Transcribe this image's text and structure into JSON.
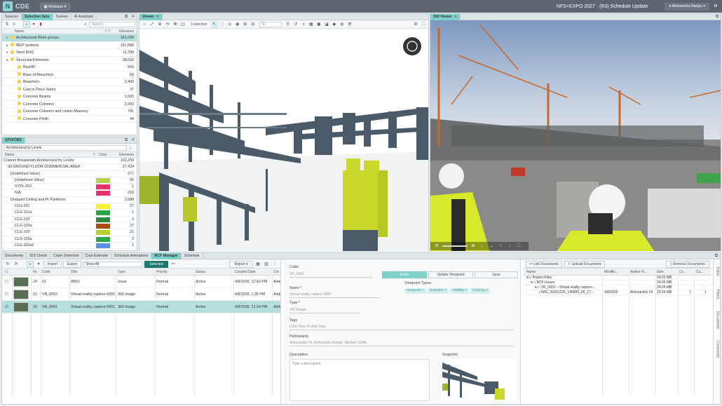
{
  "app": {
    "brand": "CDE",
    "logo": "N",
    "modules_label": "Modules",
    "project_title": "NFS+EXPO 2027 · (R3) Schedule Update",
    "user": "Aleksandra Banjac"
  },
  "left_top": {
    "tabs": [
      "Sources",
      "Selection Sets",
      "Scenes",
      "AI Assistant"
    ],
    "search_placeholder": "Search...",
    "col_name": "Name",
    "col_elements": "Elements",
    "rows": [
      {
        "label": "Architectural Work groups",
        "count": "181,028",
        "level": 0
      },
      {
        "label": "MEP systems",
        "count": "157,886",
        "level": 0
      },
      {
        "label": "Steel BOQ",
        "count": "11,780",
        "level": 0
      },
      {
        "label": "Structural Elements",
        "count": "38,592",
        "level": 0
      },
      {
        "label": "Backfill",
        "count": "665",
        "level": 1
      },
      {
        "label": "Base of Bleachers",
        "count": "69",
        "level": 1
      },
      {
        "label": "Bleachers",
        "count": "2,469",
        "level": 1
      },
      {
        "label": "Cast in Place Stairs",
        "count": "37",
        "level": 1
      },
      {
        "label": "Concrete Beams",
        "count": "1,665",
        "level": 1
      },
      {
        "label": "Concrete Columns",
        "count": "2,050",
        "level": 1
      },
      {
        "label": "Concrete Columns and Lintels Masonry",
        "count": "781",
        "level": 1
      },
      {
        "label": "Concrete Plinth",
        "count": "44",
        "level": 1
      }
    ]
  },
  "left_bottom": {
    "title": "QTO/CBS",
    "dropdown": "Architectural by Levels",
    "col_name": "Name",
    "col_color": "Color",
    "col_elements": "Elements",
    "rows": [
      {
        "label": "Custom Breakdown Architectural by Levels",
        "count": "133,209",
        "color": ""
      },
      {
        "label": "00 GROUND FLOOR COMMERCIAL AREA",
        "count": "27,424",
        "color": ""
      },
      {
        "label": "[Undefined Value]",
        "count": "277",
        "color": ""
      },
      {
        "label": "[Undefined Value]",
        "count": "66",
        "color": "#b6d24a"
      },
      {
        "label": "SYPL-002",
        "count": "1",
        "color": "#e8336a"
      },
      {
        "label": "N/A",
        "count": "210",
        "color": "#e8336a"
      },
      {
        "label": "Dropped Ceiling and Pr Partitions",
        "count": "1,088",
        "color": ""
      },
      {
        "label": "CLG-101",
        "count": "27",
        "color": "#f5f230"
      },
      {
        "label": "CLG-101a",
        "count": "1",
        "color": "#29a846"
      },
      {
        "label": "CLG-102",
        "count": "3",
        "color": "#2a8a3a"
      },
      {
        "label": "CLG-102a",
        "count": "27",
        "color": "#b04a10"
      },
      {
        "label": "CLG-103",
        "count": "21",
        "color": "#b5d32c"
      },
      {
        "label": "CLG-103a",
        "count": "3",
        "color": "#2aa84a"
      },
      {
        "label": "CLG-103a2",
        "count": "1",
        "color": "#5b8ee8"
      }
    ]
  },
  "viewer": {
    "tab": "Viewer",
    "selected": "3 selected",
    "zoom": "%"
  },
  "viewer360": {
    "tab": "360 Viewer"
  },
  "bottom": {
    "tabs": [
      "Documents",
      "IDS Check",
      "Clash Detection",
      "Cost Estimate",
      "Schedule Animations",
      "BCF Manager",
      "Schedule"
    ],
    "active_tab": "BCF Manager",
    "import": "Import",
    "export": "Export",
    "show_all": "Show All",
    "selected": "Selected",
    "report": "Report",
    "cols": [
      "Nr.",
      "Code",
      "Title",
      "Type",
      "Priority",
      "Status",
      "Created Date",
      "Cre"
    ],
    "rows": [
      {
        "nr": "24",
        "code": "01",
        "title": "AB01",
        "type": "Issue",
        "priority": "Normal",
        "status": "Active",
        "date": "4/8/2026, 12:42 PM",
        "cre": "Alek"
      },
      {
        "nr": "22",
        "code": "VR_0002",
        "title": "Virtual reality capture 0002",
        "type": "360 Image",
        "priority": "Normal",
        "status": "Active",
        "date": "4/8/2026, 1:35 PM",
        "cre": "Alek"
      },
      {
        "nr": "20",
        "code": "VR_0001",
        "title": "Virtual reality capture 0001",
        "type": "360 Image",
        "priority": "Normal",
        "status": "Active",
        "date": "4/8/2026, 12:24 PM",
        "cre": "Alek"
      }
    ]
  },
  "detail": {
    "code_label": "Code:",
    "code_value": "VR_0001",
    "active": "Active",
    "update_viewpoint": "Update Viewpoint",
    "save": "Save",
    "name_label": "Name *",
    "name_value": "Virtual reality capture 0001",
    "vp_types_label": "Viewpoint Types:",
    "vp_types": [
      "Viewpoint ×",
      "Selection ×",
      "Visibility ×",
      "Coloring ×"
    ],
    "type_label": "Type *",
    "type_value": "360 Image",
    "tags_label": "Tags",
    "tags_placeholder": "Click Here To Add Tags",
    "participants_label": "Participants",
    "participants_value": "Aleksandar Vil, Aleksandra Banjac, Michael Smith",
    "desc_label": "Description",
    "desc_placeholder": "Type a description",
    "snapshot_label": "Snapshot"
  },
  "docs": {
    "link": "Link Documents",
    "upload": "Upload Documents",
    "remove": "Remove Documents",
    "cols": [
      "Name",
      "Modific...",
      "Author N...",
      "Size",
      "Cr...",
      "Cu..."
    ],
    "rows": [
      {
        "name": "Project Files",
        "mod": "",
        "author": "",
        "size": "24.65 MB",
        "cr": "",
        "cu": "",
        "level": 0
      },
      {
        "name": "BCF Issues",
        "mod": "",
        "author": "",
        "size": "24.65 MB",
        "cr": "",
        "cu": "",
        "level": 1
      },
      {
        "name": "VR_0001 – Virtual reality capture...",
        "mod": "",
        "author": "",
        "size": "24.65 MB",
        "cr": "",
        "cu": "",
        "level": 2
      },
      {
        "name": "IMG_20251226_145800_00_17...",
        "mod": "4/8/2026",
        "author": "Aleksandra Vil",
        "size": "24.65 MB",
        "cr": "1",
        "cu": "1",
        "level": 3
      }
    ],
    "side_tabs": [
      "Editor",
      "Filters",
      "Documents",
      "Comments"
    ]
  }
}
